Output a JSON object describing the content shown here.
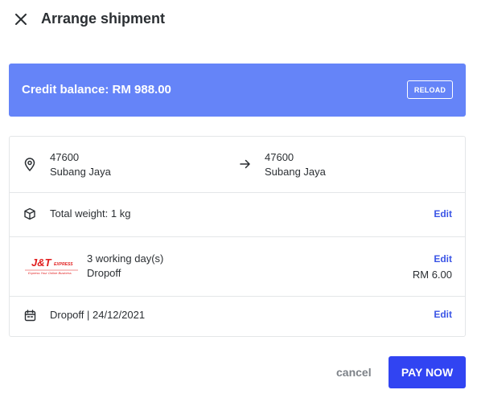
{
  "header": {
    "title": "Arrange shipment",
    "close_icon": "close-icon"
  },
  "credit": {
    "balance_text": "Credit balance: RM 988.00",
    "reload_label": "RELOAD",
    "background_color": "#6584f8"
  },
  "route": {
    "origin": {
      "postcode": "47600",
      "city": "Subang Jaya"
    },
    "destination": {
      "postcode": "47600",
      "city": "Subang Jaya"
    },
    "origin_icon": "location-pin-icon",
    "arrow_icon": "arrow-right-icon"
  },
  "weight": {
    "icon": "package-box-icon",
    "text": "Total weight: 1 kg",
    "edit_label": "Edit"
  },
  "courier": {
    "logo_text": "J&T",
    "logo_subtext": "EXPRESS",
    "logo_tagline": "Express Your Online Business",
    "duration": "3 working day(s)",
    "method": "Dropoff",
    "edit_label": "Edit",
    "price": "RM 6.00",
    "brand_color": "#e11d1d"
  },
  "dropoff": {
    "icon": "calendar-icon",
    "text": "Dropoff | 24/12/2021",
    "edit_label": "Edit"
  },
  "footer": {
    "cancel_label": "cancel",
    "pay_label": "PAY NOW",
    "pay_color": "#3144f2"
  }
}
